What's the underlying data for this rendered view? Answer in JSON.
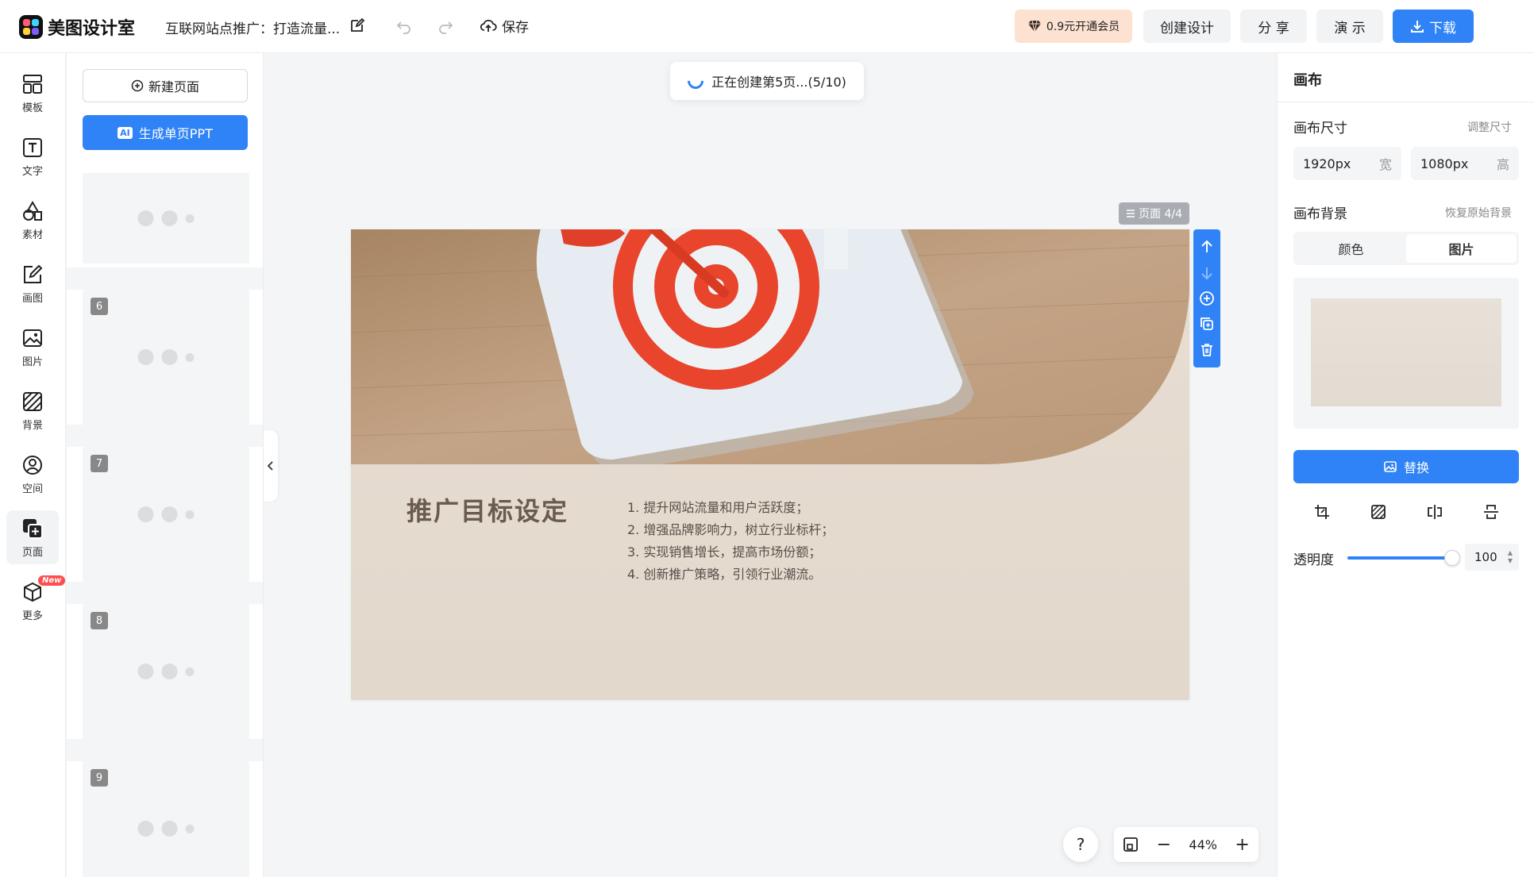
{
  "app": {
    "name": "美图设计室"
  },
  "header": {
    "doc_title": "互联网站点推广：打造流量...",
    "save_label": "保存",
    "vip_label": "0.9元开通会员",
    "create_label": "创建设计",
    "share_label": "分 享",
    "present_label": "演 示",
    "download_label": "下载"
  },
  "rail": {
    "items": [
      {
        "label": "模板",
        "icon": "template-icon"
      },
      {
        "label": "文字",
        "icon": "text-icon"
      },
      {
        "label": "素材",
        "icon": "shapes-icon"
      },
      {
        "label": "画图",
        "icon": "draw-icon"
      },
      {
        "label": "图片",
        "icon": "image-icon"
      },
      {
        "label": "背景",
        "icon": "background-icon"
      },
      {
        "label": "空间",
        "icon": "user-space-icon"
      },
      {
        "label": "页面",
        "icon": "pages-icon"
      },
      {
        "label": "更多",
        "icon": "cube-icon"
      }
    ],
    "new_badge": "New"
  },
  "pages_panel": {
    "new_page_label": "新建页面",
    "ai_chip": "AI",
    "generate_label": "生成单页PPT",
    "thumbnail_numbers": [
      "6",
      "7",
      "8",
      "9"
    ]
  },
  "canvas": {
    "status": "正在创建第5页...(5/10)",
    "page_tag": "页面 4/4",
    "slide_title": "推广目标设定",
    "slide_points": [
      "1. 提升网站流量和用户活跃度；",
      "2. 增强品牌影响力，树立行业标杆；",
      "3. 实现销售增长，提高市场份额；",
      "4. 创新推广策略，引领行业潮流。"
    ],
    "help_label": "?",
    "zoom_level": "44%",
    "zoom_out": "−",
    "zoom_in": "+"
  },
  "right_panel": {
    "title": "画布",
    "size_label": "画布尺寸",
    "resize_link": "调整尺寸",
    "width_value": "1920px",
    "width_unit": "宽",
    "height_value": "1080px",
    "height_unit": "高",
    "bg_label": "画布背景",
    "restore_link": "恢复原始背景",
    "tab_color": "颜色",
    "tab_image": "图片",
    "replace_label": "替换",
    "opacity_label": "透明度",
    "opacity_value": "100",
    "opacity_level": 1.0
  },
  "colors": {
    "accent": "#2f83f6",
    "vip_bg": "#fde2d2",
    "slide_title": "#6a5a50",
    "target_red": "#e8452c"
  }
}
